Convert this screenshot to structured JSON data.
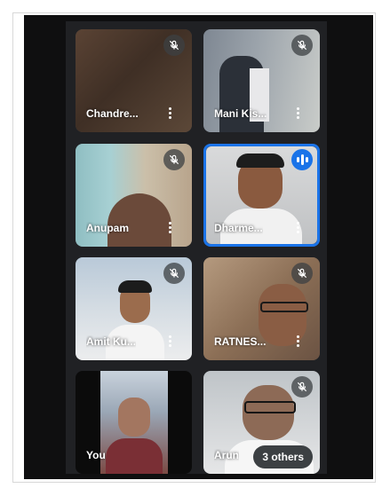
{
  "participants": [
    {
      "name": "Chandre...",
      "muted": true
    },
    {
      "name": "Mani Kis...",
      "muted": true
    },
    {
      "name": "Anupam",
      "muted": true
    },
    {
      "name": "Dharme...",
      "muted": false,
      "speaking": true
    },
    {
      "name": "Amit Ku...",
      "muted": true
    },
    {
      "name": "RATNES...",
      "muted": true
    },
    {
      "name": "You",
      "muted": false
    },
    {
      "name": "Arun",
      "muted": true
    }
  ],
  "others_button": {
    "label": "3 others"
  },
  "colors": {
    "accent": "#1a73e8",
    "tile_bg": "#3c4043",
    "panel_bg": "#202124"
  },
  "icons": {
    "mute": "mic-off-icon",
    "more": "more-vert-icon",
    "speaking": "audio-level-icon"
  }
}
